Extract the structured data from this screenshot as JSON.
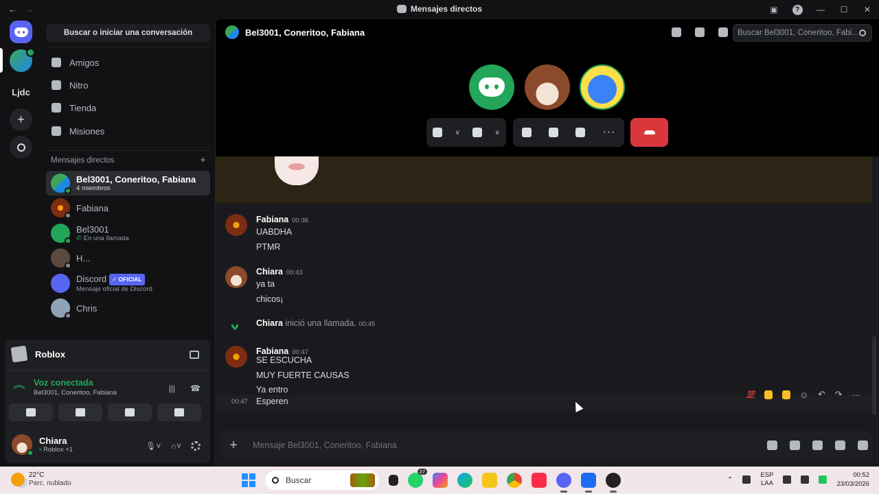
{
  "window": {
    "title": "Mensajes directos",
    "back": "←",
    "forward": "→",
    "controls": [
      "—",
      "☐",
      "✕"
    ]
  },
  "rail": {
    "server_ljdc": "Ljdc",
    "add": "+"
  },
  "dm_column": {
    "search_button": "Buscar o iniciar una conversación",
    "nav": [
      {
        "label": "Amigos",
        "icon": "friends-icon"
      },
      {
        "label": "Nitro",
        "icon": "nitro-icon"
      },
      {
        "label": "Tienda",
        "icon": "shop-icon"
      },
      {
        "label": "Misiones",
        "icon": "quests-icon"
      }
    ],
    "section_title": "Mensajes directos",
    "section_add": "+",
    "items": [
      {
        "name": "Bel3001, Coneritoo, Fabiana",
        "sub": "4 miembros",
        "active": true
      },
      {
        "name": "Fabiana",
        "sub": ""
      },
      {
        "name": "Bel3001",
        "sub": "En una llamada"
      },
      {
        "name": "H...",
        "sub": ""
      },
      {
        "name": "Discord",
        "badge": "✓ OFICIAL",
        "sub": "Mensaje oficial de Discord"
      },
      {
        "name": "Chris",
        "sub": ""
      }
    ]
  },
  "panel": {
    "game": "Roblox",
    "voice_title": "Voz conectada",
    "voice_sub": "Bel3001, Coneritoo, Fabiana",
    "user_name": "Chiara",
    "user_status": "Roblox +1"
  },
  "header": {
    "channel": "Bel3001, Coneritoo, Fabiana",
    "search_placeholder": "Buscar Bel3001, Coneritoo, Fabi..."
  },
  "messages": [
    {
      "author": "Fabiana",
      "time": "00:36",
      "lines": [
        "UABDHA",
        "PTMR"
      ]
    },
    {
      "author": "Chiara",
      "time": "00:43",
      "lines": [
        "ya ta",
        "chicos¡"
      ]
    },
    {
      "author": "Fabiana",
      "time": "00:47",
      "lines": [
        "SE ESCUCHA",
        "MUY FUERTE CAUSAS",
        "Ya entro"
      ]
    }
  ],
  "system_message": {
    "author": "Chiara",
    "text": "inició una llamada.",
    "time": "00:45"
  },
  "hover_message": {
    "time": "00:47",
    "text": "Esperen"
  },
  "reactions": {
    "hundred": "💯"
  },
  "composer": {
    "placeholder": "Mensaje Bel3001, Coneritoo, Fabiana",
    "plus": "+"
  },
  "taskbar": {
    "temp": "22°C",
    "weather": "Parc. nublado",
    "search": "Buscar",
    "whatsapp_count": "27",
    "lang1": "ESP",
    "lang2": "LAA",
    "time": "00:52",
    "date": "23/03/2026"
  },
  "colors": {
    "accent": "#5865f2",
    "online": "#23a55a",
    "danger": "#da373c"
  }
}
